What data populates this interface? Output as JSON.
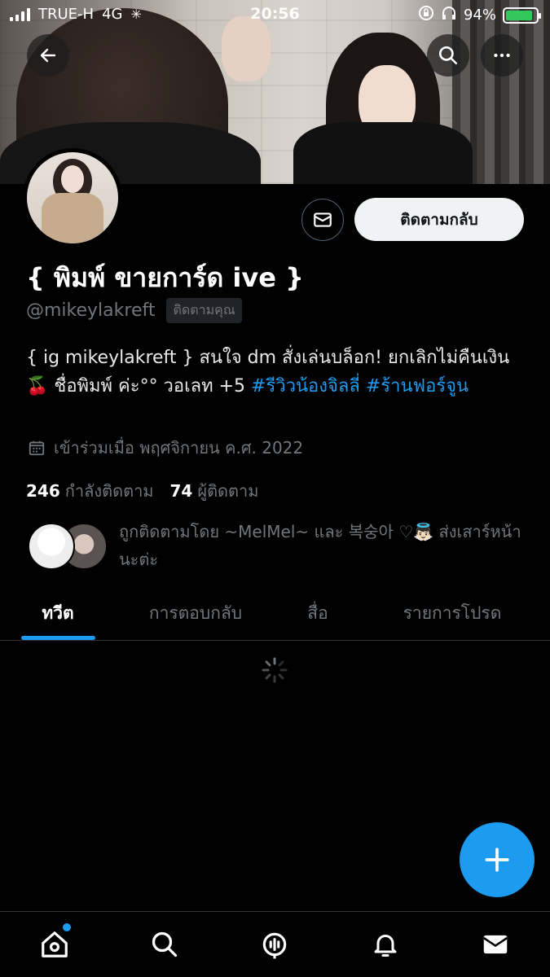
{
  "status_bar": {
    "carrier": "TRUE-H",
    "network": "4G",
    "time": "20:56",
    "battery": "94%"
  },
  "profile": {
    "display_name": "{ พิมพ์ ขายการ์ด ive }",
    "handle": "@mikeylakreft",
    "follows_you": "ติดตามคุณ",
    "follow_back_label": "ติดตามกลับ",
    "bio_text": "{ ig mikeylakreft } สนใจ dm สั่งเล่นบล็อก! ยกเลิกไม่คืนเงิน 🍒 ชื่อพิมพ์ ค่ะ°° วอเลท +5 ",
    "bio_tag_1": "#รีวิวน้องจิลลี่",
    "bio_tag_2": "#ร้านฟอร์จูน",
    "joined": "เข้าร่วมเมื่อ พฤศจิกายน ค.ศ. 2022",
    "following_count": "246",
    "following_label": "กำลังติดตาม",
    "followers_count": "74",
    "followers_label": "ผู้ติดตาม",
    "followed_by": "ถูกติดตามโดย ~MelMel~ และ 복숭아 ♡👼🏻 ส่งเสาร์หน้านะต่ะ"
  },
  "tabs": [
    {
      "label": "ทวีต",
      "active": true
    },
    {
      "label": "การตอบกลับ",
      "active": false
    },
    {
      "label": "สื่อ",
      "active": false
    },
    {
      "label": "รายการโปรด",
      "active": false
    }
  ],
  "bottom_nav": [
    "home-icon",
    "search-icon",
    "spaces-icon",
    "notifications-icon",
    "messages-icon"
  ],
  "colors": {
    "accent": "#1d9bf0",
    "background": "#000000",
    "secondary_text": "#71767b"
  }
}
